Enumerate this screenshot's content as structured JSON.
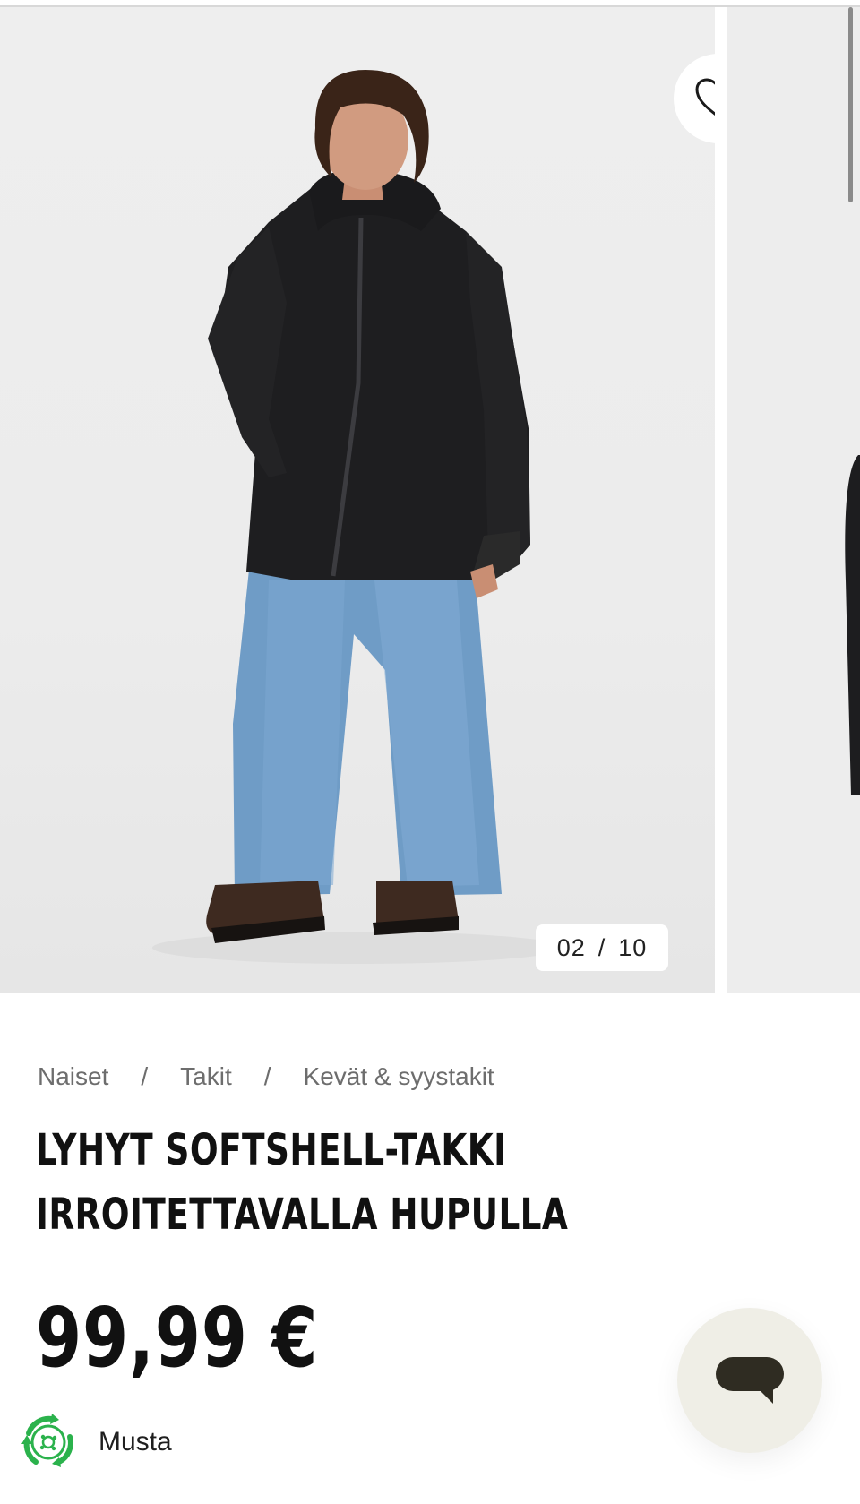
{
  "gallery": {
    "current": "02",
    "separator": "/",
    "total": "10",
    "favorite_icon": "heart-outline-icon"
  },
  "breadcrumb": {
    "items": [
      "Naiset",
      "Takit",
      "Kevät & syystakit"
    ],
    "separator": "/"
  },
  "product": {
    "title_line1": "LYHYT SOFTSHELL-TAKKI",
    "title_line2": "IRROITETTAVALLA HUPULLA",
    "price": "99,99 €",
    "color": "Musta",
    "eco_icon": "sustainability-recycle-icon"
  },
  "chat": {
    "icon": "chat-bubble-icon",
    "color": "#2f2c22"
  },
  "colors": {
    "eco_green": "#2bb24c",
    "text": "#111111",
    "muted": "#6d6d6d"
  }
}
